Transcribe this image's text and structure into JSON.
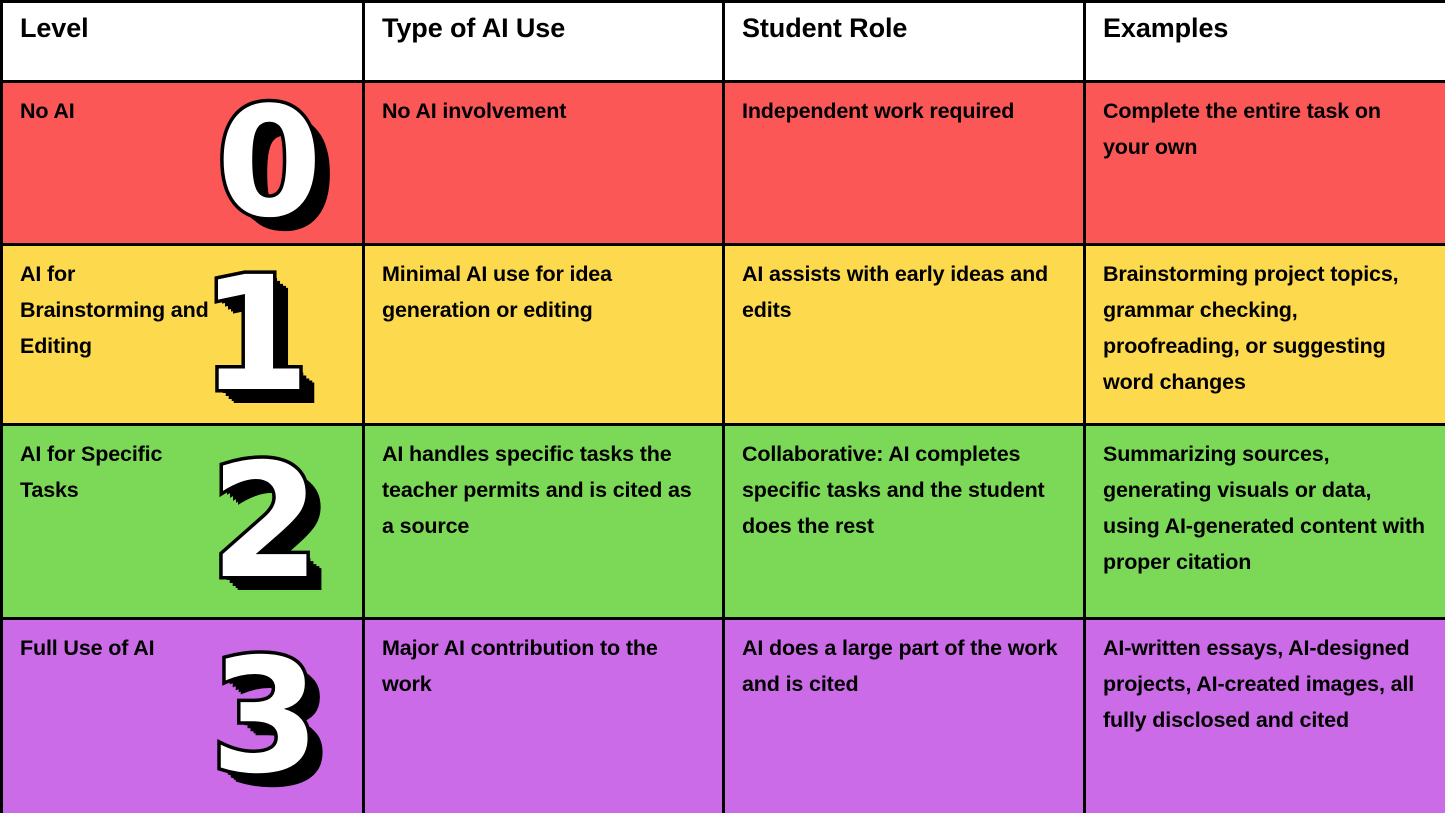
{
  "table": {
    "columns": [
      {
        "key": "level",
        "label": "Level"
      },
      {
        "key": "type",
        "label": "Type of AI Use"
      },
      {
        "key": "role",
        "label": "Student Role"
      },
      {
        "key": "examples",
        "label": "Examples"
      }
    ],
    "rows": [
      {
        "number": "0",
        "level": "No AI",
        "type": "No AI involvement",
        "role": "Independent work required",
        "examples": "Complete the entire task on your own",
        "color": "#FB5757",
        "color_name": "red"
      },
      {
        "number": "1",
        "level": "AI for Brainstorming and Editing",
        "type": "Minimal AI use for idea generation or editing",
        "role": "AI assists with early ideas and edits",
        "examples": "Brainstorming project topics, grammar checking, proofreading, or suggesting word changes",
        "color": "#FDD94E",
        "color_name": "yellow"
      },
      {
        "number": "2",
        "level": "AI for Specific Tasks",
        "type": "AI handles specific tasks the teacher permits and is cited as a source",
        "role": "Collaborative: AI completes specific tasks and the student does the rest",
        "examples": "Summarizing sources, generating visuals or data, using AI-generated content with proper citation",
        "color": "#7CD957",
        "color_name": "green"
      },
      {
        "number": "3",
        "level": "Full Use of AI",
        "type": "Major AI contribution to the work",
        "role": "AI does a large part of the work and is cited",
        "examples": "AI-written essays, AI-designed projects, AI-created images, all fully disclosed and cited",
        "color": "#CC6BE8",
        "color_name": "purple"
      }
    ]
  },
  "chart_data": {
    "type": "table",
    "title": "",
    "columns": [
      "Level",
      "Type of AI Use",
      "Student Role",
      "Examples"
    ],
    "rows": [
      [
        "No AI",
        "No AI involvement",
        "Independent work required",
        "Complete the entire task on your own"
      ],
      [
        "AI for Brainstorming and Editing",
        "Minimal AI use for idea generation or editing",
        "AI assists with early ideas and edits",
        "Brainstorming project topics, grammar checking, proofreading, or suggesting word changes"
      ],
      [
        "AI for Specific Tasks",
        "AI handles specific tasks the teacher permits and is cited as a source",
        "Collaborative: AI completes specific tasks and the student does the rest",
        "Summarizing sources, generating visuals or data, using AI-generated content with proper citation"
      ],
      [
        "Full Use of AI",
        "Major AI contribution to the work",
        "AI does a large part of the work and is cited",
        "AI-written essays, AI-designed projects, AI-created images, all fully disclosed and cited"
      ]
    ],
    "level_numbers": [
      "0",
      "1",
      "2",
      "3"
    ],
    "row_colors": [
      "#FB5757",
      "#FDD94E",
      "#7CD957",
      "#CC6BE8"
    ],
    "header_background": "#FFFFFF",
    "border_color": "#000000",
    "text_color": "#000000",
    "numeral_fill": "#FFFFFF",
    "numeral_shadow": "#000000"
  }
}
